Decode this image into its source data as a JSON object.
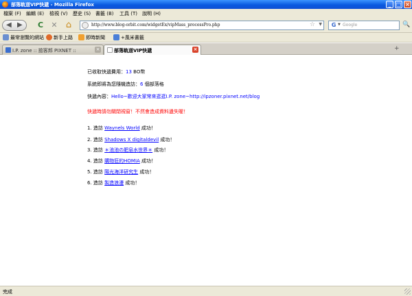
{
  "window": {
    "title": "部落軌道VIP快遞 - Mozilla Firefox",
    "min_glyph": "_",
    "max_glyph": "□",
    "close_glyph": "×"
  },
  "menu": [
    "檔案 (F)",
    "編輯 (E)",
    "檢視 (V)",
    "歷史 (S)",
    "書籤 (B)",
    "工具 (T)",
    "說明 (H)"
  ],
  "nav": {
    "back_glyph": "◀",
    "forward_glyph": "▶",
    "reload_glyph": "C",
    "stop_glyph": "✕",
    "home_glyph": "⌂",
    "url": "http://www.blog-orbit.com/widgetEx/vipMass_processPro.php",
    "star_glyph": "☆",
    "drop_glyph": "▼",
    "search_engine_glyph": "G",
    "search_drop_glyph": "▼",
    "search_placeholder": "Google",
    "search_button_glyph": "🔍"
  },
  "bookmarks": [
    {
      "label": "最常瀏覽的網站",
      "color": "#6a8fd0"
    },
    {
      "label": "新手上路",
      "color": "#e06a2a"
    },
    {
      "label": "即時新聞",
      "color": "#f0a030"
    },
    {
      "label": "+風米書籤",
      "color": "#4a7fd8"
    }
  ],
  "tabs": [
    {
      "label": "I.P. zone :: 撿客邦 PIXNET ::",
      "active": false,
      "close_glyph": "×"
    },
    {
      "label": "部落軌道VIP快遞",
      "active": true,
      "close_glyph": "×"
    }
  ],
  "newtab_glyph": "+",
  "content": {
    "fee_label": "已收取快遞費用：",
    "fee_value": "13",
    "fee_unit": " BO幣",
    "blogs_label": "系統即將為您隨機造訪：",
    "blogs_value": "6",
    "blogs_unit": " 個部落格",
    "message_label": "快遞內容：",
    "message_value": "Hello~歡迎大家常來逛逛I.P. zone~http://ipzoner.pixnet.net/blog",
    "warning": "快遞時請勿關閉視窗！不然會造成資料遺失喔！",
    "visits": [
      {
        "num": "1. 造訪",
        "name": "Waynels World",
        "result": " 成功！"
      },
      {
        "num": "2. 造訪",
        "name": "Shadows X digitaldevil",
        "result": " 成功！"
      },
      {
        "num": "3. 造訪",
        "name": "＊池池の肥皂水世界＊",
        "result": " 成功！"
      },
      {
        "num": "4. 造訪",
        "name": "購物狂的HOMIA",
        "result": " 成功！"
      },
      {
        "num": "5. 造訪",
        "name": "陽光海洋研究生",
        "result": " 成功！"
      },
      {
        "num": "6. 造訪",
        "name": "製造浪漫",
        "result": " 成功！"
      }
    ]
  },
  "status": "完成"
}
